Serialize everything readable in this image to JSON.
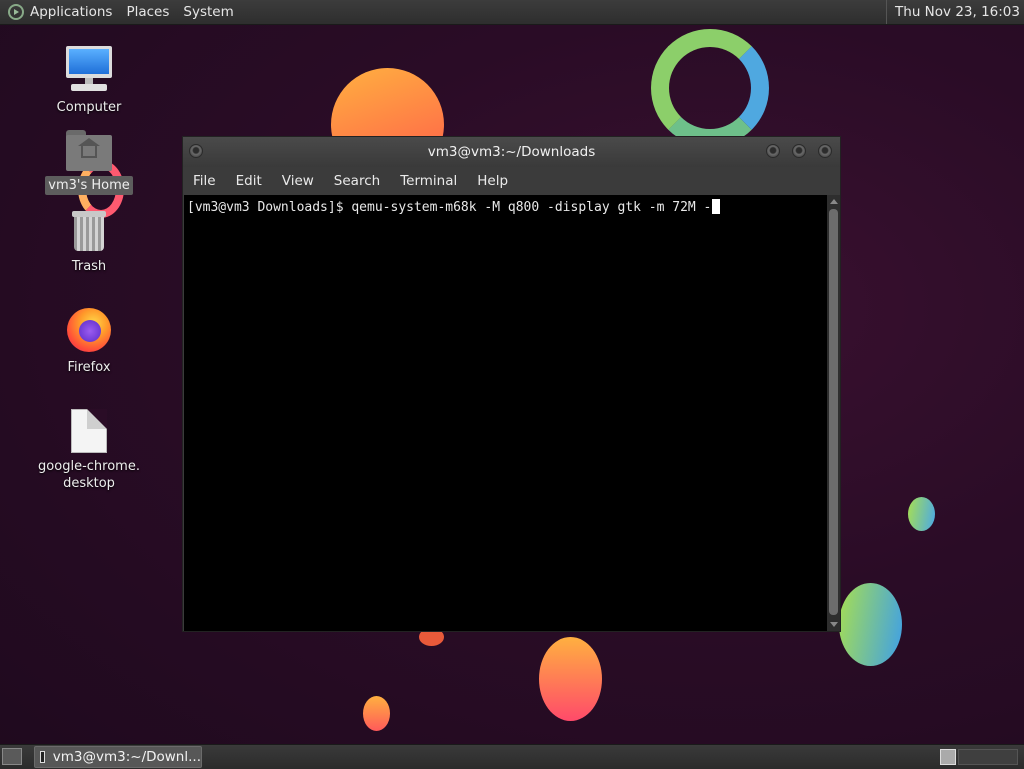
{
  "top_panel": {
    "menus": [
      "Applications",
      "Places",
      "System"
    ],
    "clock": "Thu Nov 23, 16:03"
  },
  "desktop": {
    "icons": [
      {
        "label": "Computer"
      },
      {
        "label": "vm3's Home"
      },
      {
        "label": "Trash"
      },
      {
        "label": "Firefox"
      },
      {
        "label": "google-chrome.\ndesktop"
      }
    ]
  },
  "terminal": {
    "title": "vm3@vm3:~/Downloads",
    "menus": [
      "File",
      "Edit",
      "View",
      "Search",
      "Terminal",
      "Help"
    ],
    "command_line": "[vm3@vm3 Downloads]$ qemu-system-m68k -M q800 -display gtk -m 72M -"
  },
  "taskbar": {
    "task_label": "vm3@vm3:~/Downl..."
  },
  "icons": {
    "logo": "gnome-foot-icon",
    "computer": "computer-icon",
    "home": "home-folder-icon",
    "trash": "trash-icon",
    "firefox": "firefox-icon",
    "file": "text-file-icon"
  }
}
